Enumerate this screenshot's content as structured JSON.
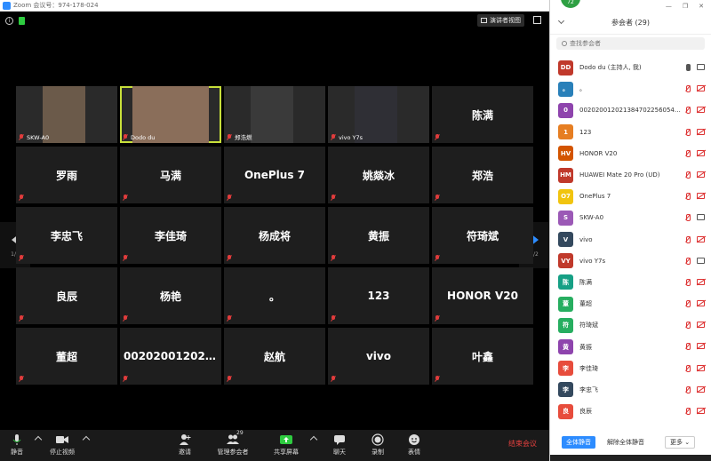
{
  "window": {
    "title": "Zoom 会议号：974-178-024"
  },
  "meeting": {
    "speaker_view_label": "演讲者视图",
    "pager": {
      "left_page": "1/2",
      "right_page": "1/2"
    },
    "tiles": [
      {
        "label": "SKW-A0",
        "name": "",
        "video": true
      },
      {
        "label": "Dodo du",
        "name": "",
        "video": true,
        "active": true
      },
      {
        "label": "郑浩燃",
        "name": "",
        "video": true
      },
      {
        "label": "vivo Y7s",
        "name": "",
        "video": true
      },
      {
        "label": "",
        "name": "陈满"
      },
      {
        "label": "",
        "name": "罗雨"
      },
      {
        "label": "",
        "name": "马满"
      },
      {
        "label": "",
        "name": "OnePlus 7"
      },
      {
        "label": "",
        "name": "姚燚冰"
      },
      {
        "label": "",
        "name": "郑浩"
      },
      {
        "label": "",
        "name": "李忠飞"
      },
      {
        "label": "",
        "name": "李佳琦"
      },
      {
        "label": "",
        "name": "杨成将"
      },
      {
        "label": "",
        "name": "黄振"
      },
      {
        "label": "",
        "name": "符琦斌"
      },
      {
        "label": "",
        "name": "良辰"
      },
      {
        "label": "",
        "name": "杨艳"
      },
      {
        "label": "",
        "name": "。"
      },
      {
        "label": "",
        "name": "123"
      },
      {
        "label": "",
        "name": "HONOR V20"
      },
      {
        "label": "",
        "name": "董超"
      },
      {
        "label": "",
        "name": "0020200120213..."
      },
      {
        "label": "",
        "name": "赵航"
      },
      {
        "label": "",
        "name": "vivo"
      },
      {
        "label": "",
        "name": "叶鑫"
      }
    ]
  },
  "toolbar": {
    "mute": "静音",
    "stop_video": "停止视频",
    "invite": "邀请",
    "manage_participants": "管理参会者",
    "participant_count": "29",
    "share_screen": "共享屏幕",
    "chat": "聊天",
    "record": "录制",
    "reactions": "表情",
    "end_meeting": "结束会议"
  },
  "panel": {
    "live_badge": "72",
    "title": "参会者 (29)",
    "search_placeholder": "查找参会者",
    "participants": [
      {
        "initials": "DD",
        "color": "#c0392b",
        "name": "Dodo du (主持人, 我)",
        "mic_on": true,
        "cam_on": true
      },
      {
        "initials": "。",
        "color": "#2980b9",
        "name": "。",
        "mic_on": false,
        "cam_on": false
      },
      {
        "initials": "0",
        "color": "#8e44ad",
        "name": "0020200120213847022560548346",
        "mic_on": false,
        "cam_on": false
      },
      {
        "initials": "1",
        "color": "#e67e22",
        "name": "123",
        "mic_on": false,
        "cam_on": false
      },
      {
        "initials": "HV",
        "color": "#d35400",
        "name": "HONOR V20",
        "mic_on": false,
        "cam_on": false
      },
      {
        "initials": "HM",
        "color": "#c0392b",
        "name": "HUAWEI Mate 20 Pro (UD)",
        "mic_on": false,
        "cam_on": false
      },
      {
        "initials": "O7",
        "color": "#f1c40f",
        "name": "OnePlus 7",
        "mic_on": false,
        "cam_on": false
      },
      {
        "initials": "S",
        "color": "#9b59b6",
        "name": "SKW-A0",
        "mic_on": false,
        "cam_on": true
      },
      {
        "initials": "V",
        "color": "#34495e",
        "name": "vivo",
        "mic_on": false,
        "cam_on": false
      },
      {
        "initials": "VY",
        "color": "#c0392b",
        "name": "vivo Y7s",
        "mic_on": false,
        "cam_on": true
      },
      {
        "initials": "陈",
        "color": "#16a085",
        "name": "陈满",
        "mic_on": false,
        "cam_on": false
      },
      {
        "initials": "董",
        "color": "#27ae60",
        "name": "董超",
        "mic_on": false,
        "cam_on": false
      },
      {
        "initials": "符",
        "color": "#27ae60",
        "name": "符琦斌",
        "mic_on": false,
        "cam_on": false
      },
      {
        "initials": "黄",
        "color": "#8e44ad",
        "name": "黄振",
        "mic_on": false,
        "cam_on": false
      },
      {
        "initials": "李",
        "color": "#e74c3c",
        "name": "李佳琦",
        "mic_on": false,
        "cam_on": false
      },
      {
        "initials": "李",
        "color": "#34495e",
        "name": "李忠飞",
        "mic_on": false,
        "cam_on": false
      },
      {
        "initials": "良",
        "color": "#e74c3c",
        "name": "良辰",
        "mic_on": false,
        "cam_on": false
      }
    ],
    "mute_all": "全体静音",
    "unmute_all": "解除全体静音",
    "more": "更多"
  }
}
